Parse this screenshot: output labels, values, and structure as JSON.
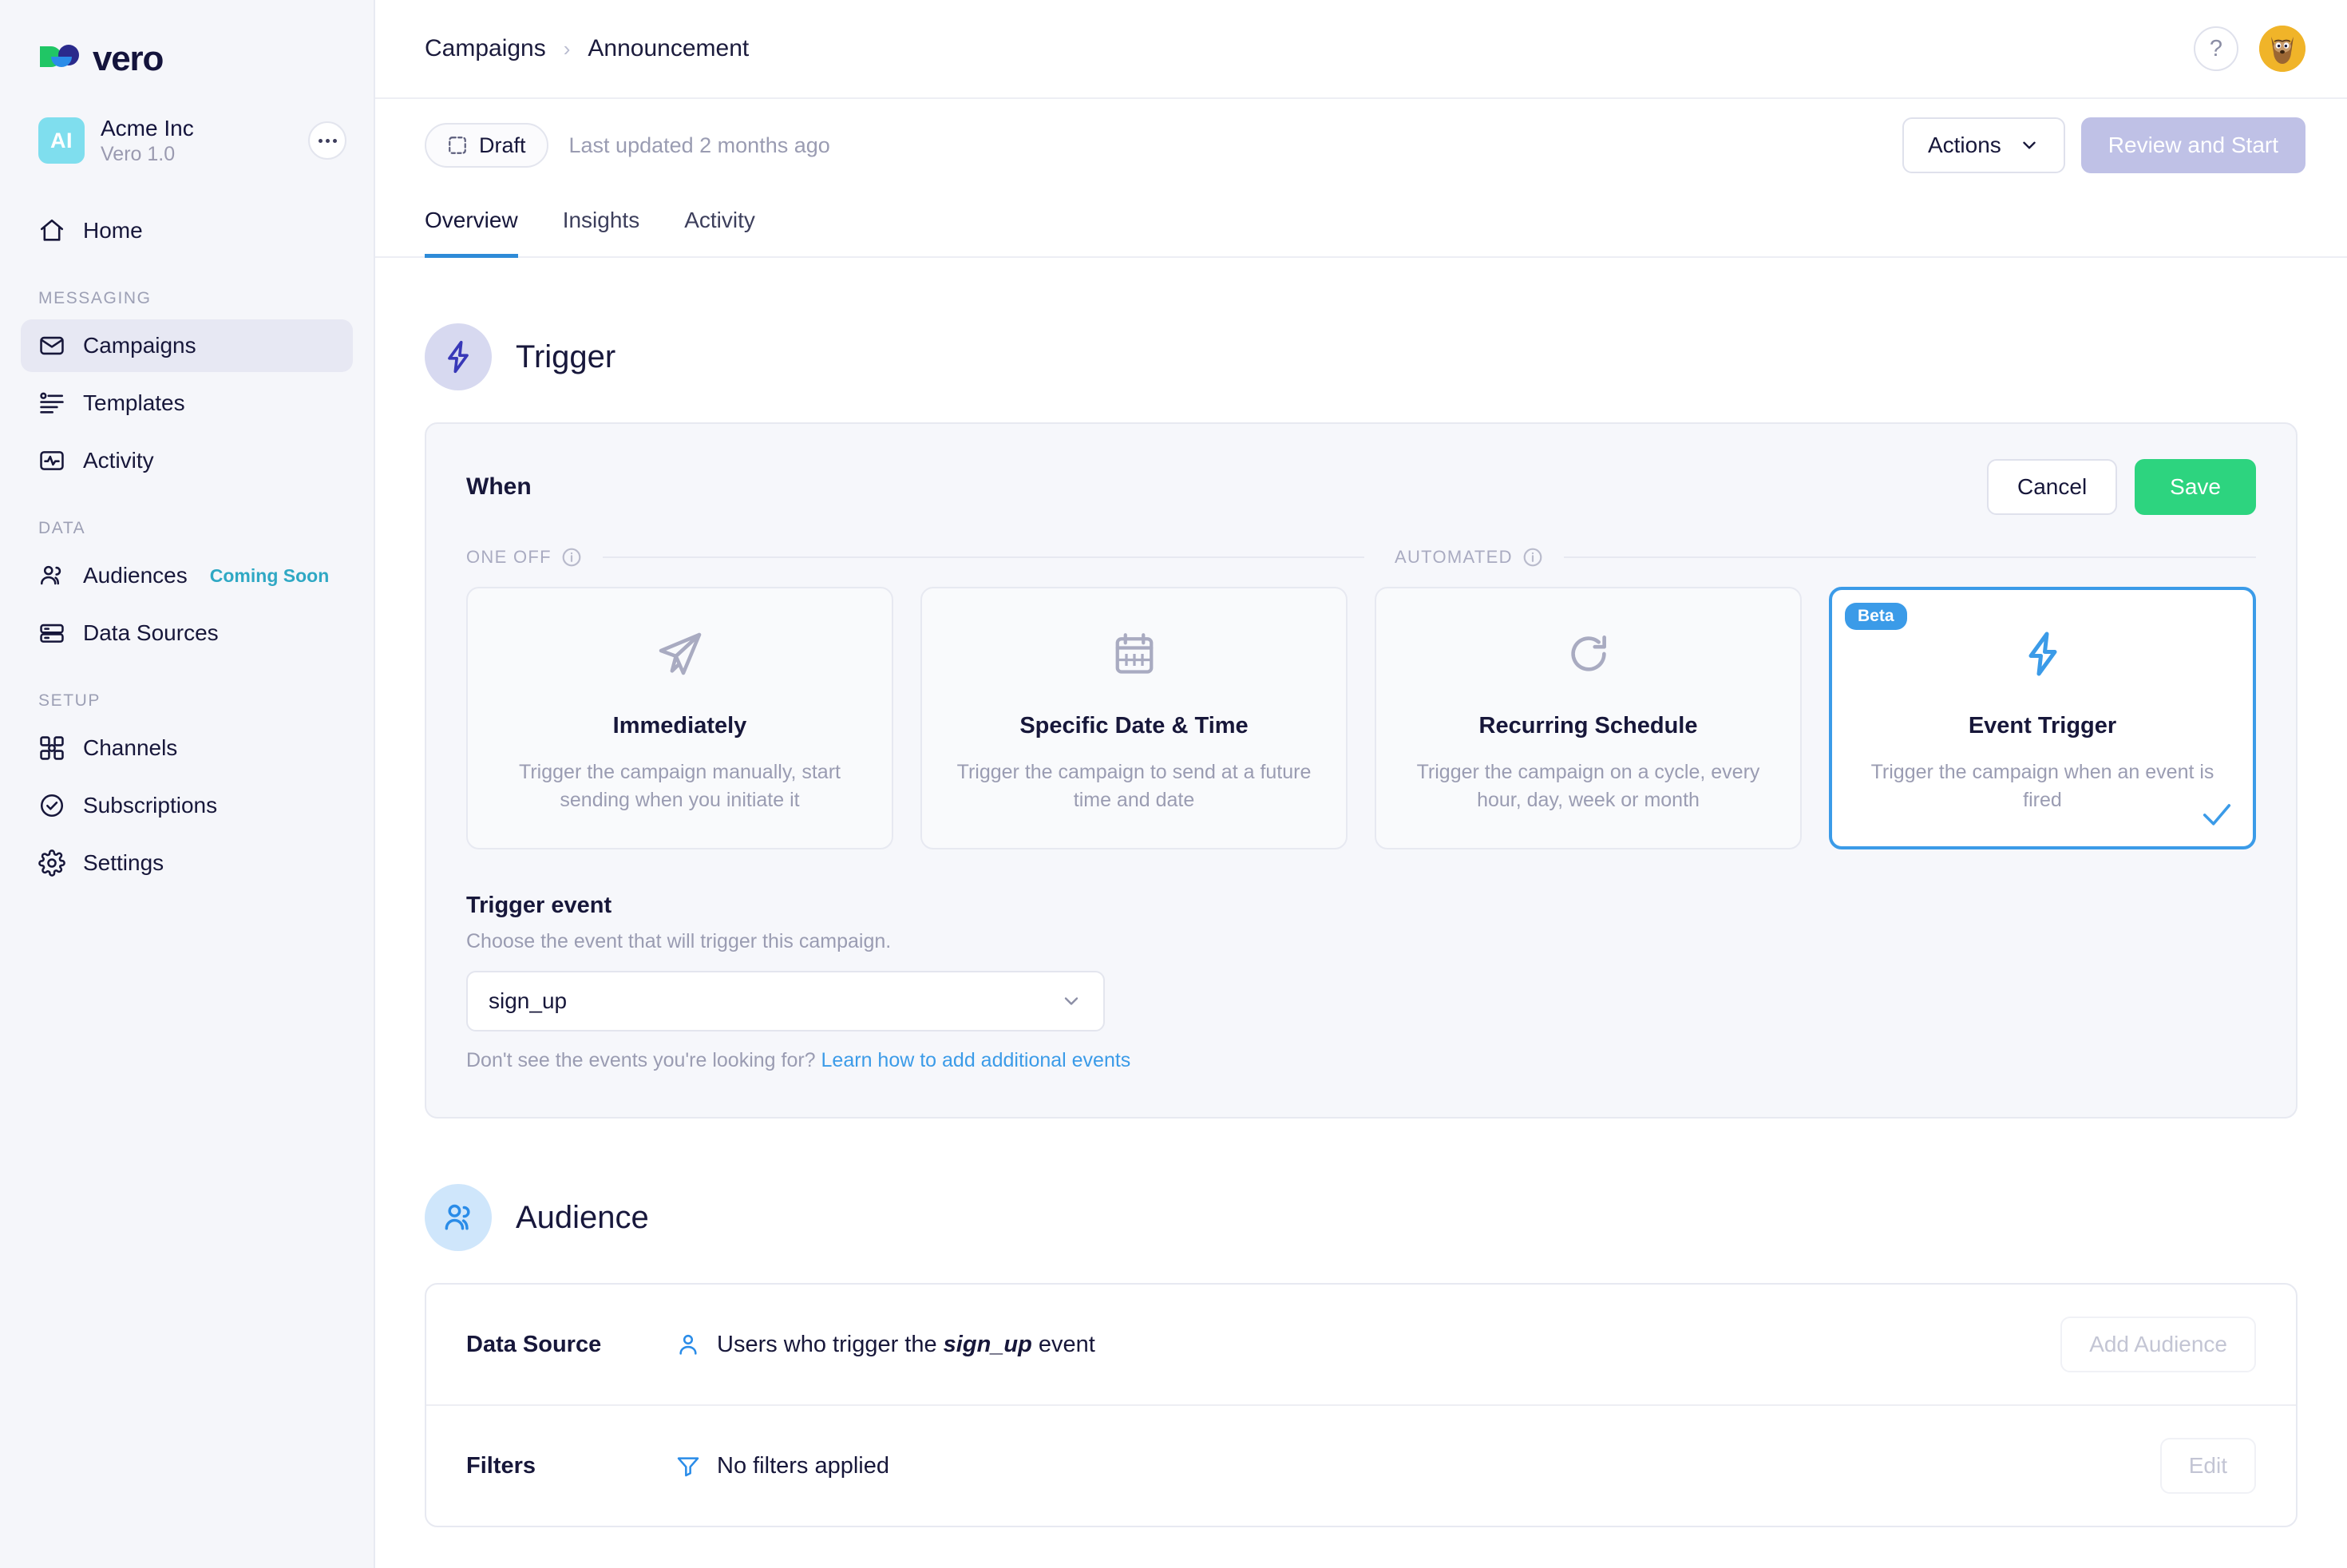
{
  "brand": {
    "name": "vero"
  },
  "account": {
    "initials": "AI",
    "name": "Acme Inc",
    "plan": "Vero 1.0",
    "menu_icon": "ellipsis-icon"
  },
  "sidebar": {
    "groups": [
      {
        "label": "",
        "items": [
          {
            "label": "Home",
            "icon": "home-icon",
            "active": false
          }
        ]
      },
      {
        "label": "MESSAGING",
        "items": [
          {
            "label": "Campaigns",
            "icon": "envelope-icon",
            "active": true
          },
          {
            "label": "Templates",
            "icon": "template-icon",
            "active": false
          },
          {
            "label": "Activity",
            "icon": "activity-icon",
            "active": false
          }
        ]
      },
      {
        "label": "DATA",
        "items": [
          {
            "label": "Audiences",
            "icon": "users-icon",
            "active": false,
            "badge": "Coming Soon"
          },
          {
            "label": "Data Sources",
            "icon": "database-icon",
            "active": false
          }
        ]
      },
      {
        "label": "SETUP",
        "items": [
          {
            "label": "Channels",
            "icon": "channels-icon",
            "active": false
          },
          {
            "label": "Subscriptions",
            "icon": "check-circle-icon",
            "active": false
          },
          {
            "label": "Settings",
            "icon": "gear-icon",
            "active": false
          }
        ]
      }
    ]
  },
  "topbar": {
    "breadcrumb_parent": "Campaigns",
    "breadcrumb_separator": "›",
    "breadcrumb_current": "Announcement",
    "help_label": "?",
    "help_icon": "question-mark-icon",
    "avatar_icon": "user-avatar"
  },
  "actionbar": {
    "status": "Draft",
    "status_icon": "dashed-square-icon",
    "last_updated": "Last updated 2 months ago",
    "actions_label": "Actions",
    "actions_icon": "chevron-down-icon",
    "review_label": "Review and Start"
  },
  "tabs": [
    {
      "label": "Overview",
      "active": true
    },
    {
      "label": "Insights",
      "active": false
    },
    {
      "label": "Activity",
      "active": false
    }
  ],
  "trigger": {
    "section_title": "Trigger",
    "section_icon": "lightning-bolt-icon",
    "panel_title": "When",
    "cancel_label": "Cancel",
    "save_label": "Save",
    "group_one_off": "ONE OFF",
    "group_automated": "AUTOMATED",
    "info_icon": "info-icon",
    "options": [
      {
        "title": "Immediately",
        "desc": "Trigger the campaign manually, start sending when you initiate it",
        "icon": "paper-plane-icon",
        "selected": false,
        "badge": ""
      },
      {
        "title": "Specific Date & Time",
        "desc": "Trigger the campaign to send at a future time and date",
        "icon": "calendar-icon",
        "selected": false,
        "badge": ""
      },
      {
        "title": "Recurring Schedule",
        "desc": "Trigger the campaign on a cycle, every hour, day, week or month",
        "icon": "refresh-icon",
        "selected": false,
        "badge": ""
      },
      {
        "title": "Event Trigger",
        "desc": "Trigger the campaign when an event is fired",
        "icon": "lightning-bolt-icon",
        "selected": true,
        "badge": "Beta"
      }
    ],
    "field_label": "Trigger event",
    "field_hint": "Choose the event that will trigger this campaign.",
    "selected_event": "sign_up",
    "select_icon": "chevron-down-icon",
    "foot_text": "Don't see the events you're looking for? ",
    "foot_link": "Learn how to add additional events"
  },
  "audience": {
    "section_title": "Audience",
    "section_icon": "user-group-icon",
    "rows": [
      {
        "label": "Data Source",
        "icon": "person-icon",
        "value_prefix": "Users who trigger the ",
        "value_strong": "sign_up",
        "value_suffix": " event",
        "button": "Add Audience"
      },
      {
        "label": "Filters",
        "icon": "filter-icon",
        "value_prefix": "No filters applied",
        "value_strong": "",
        "value_suffix": "",
        "button": "Edit"
      }
    ]
  },
  "colors": {
    "accent_blue": "#3b9be8",
    "save_green": "#2dd47f",
    "disabled_purple": "#bfc1e6",
    "coming_soon_teal": "#2fa8c4",
    "sidebar_bg": "#f5f6fa",
    "panel_bg": "#f6f7fb",
    "text_dark": "#17173a",
    "text_muted": "#9a9cb2"
  }
}
